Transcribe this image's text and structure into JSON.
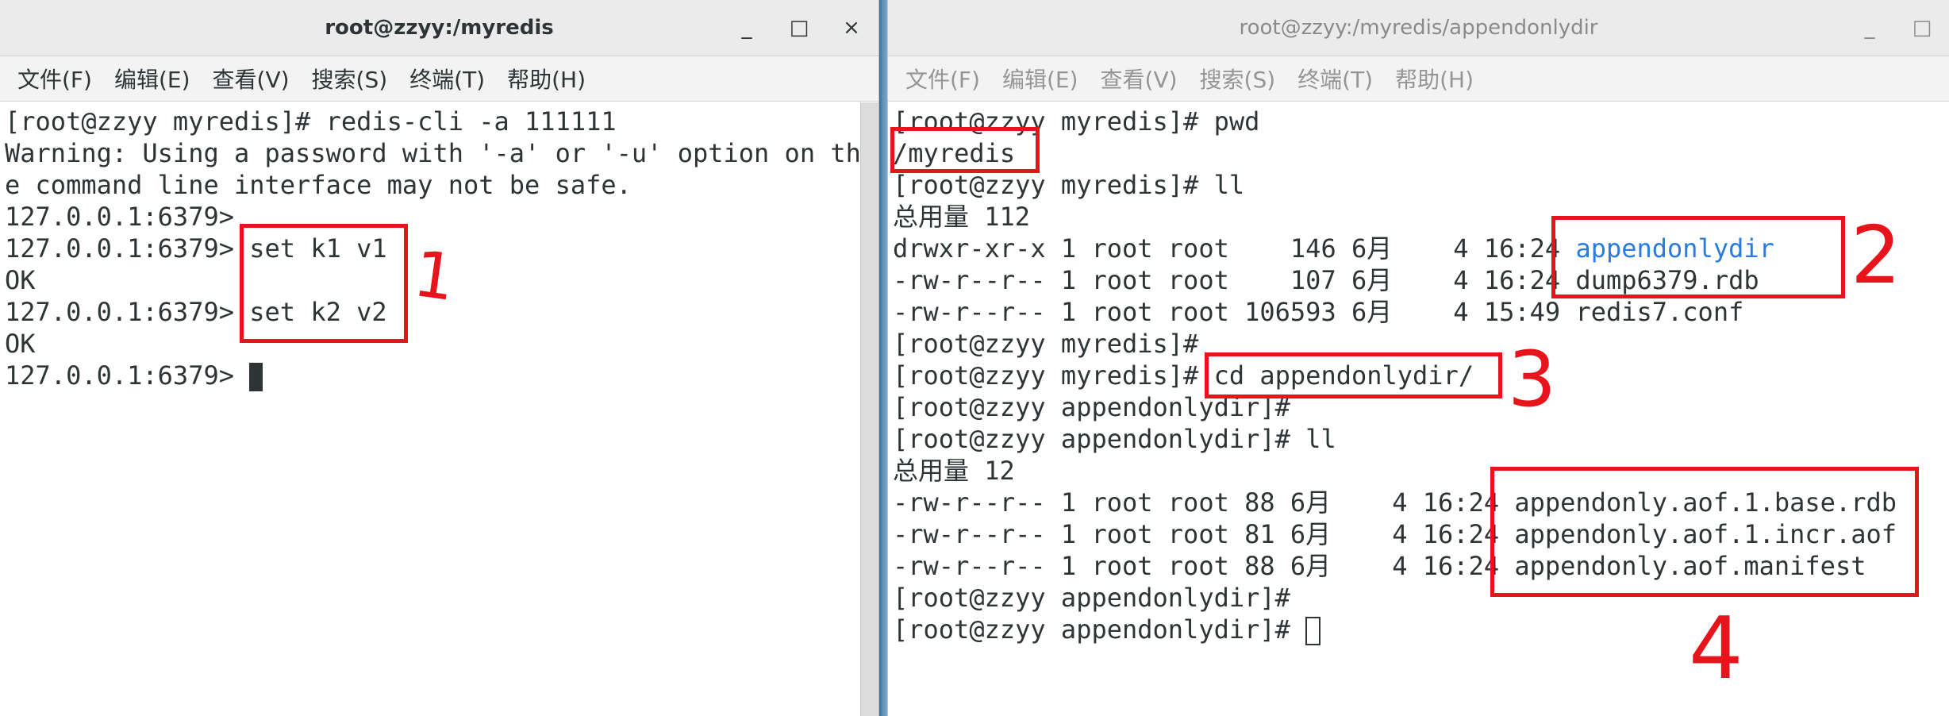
{
  "left_window": {
    "title": "root@zzyy:/myredis",
    "controls": {
      "minimize": "_",
      "maximize": "□",
      "close": "×"
    },
    "menu": [
      "文件(F)",
      "编辑(E)",
      "查看(V)",
      "搜索(S)",
      "终端(T)",
      "帮助(H)"
    ],
    "lines": [
      "[root@zzyy myredis]# redis-cli -a 111111",
      "Warning: Using a password with '-a' or '-u' option on th",
      "e command line interface may not be safe.",
      "127.0.0.1:6379>",
      "127.0.0.1:6379> set k1 v1",
      "OK",
      "127.0.0.1:6379> set k2 v2",
      "OK",
      "127.0.0.1:6379> "
    ]
  },
  "right_window": {
    "title": "root@zzyy:/myredis/appendonlydir",
    "controls": {
      "minimize": "_",
      "maximize": "□"
    },
    "menu": [
      "文件(F)",
      "编辑(E)",
      "查看(V)",
      "搜索(S)",
      "终端(T)",
      "帮助(H)"
    ],
    "lines": [
      "[root@zzyy myredis]# pwd",
      "/myredis",
      "[root@zzyy myredis]# ll",
      "总用量 112",
      {
        "prefix": "drwxr-xr-x 1 root root    146 6月    4 16:24 ",
        "name": "appendonlydir"
      },
      "-rw-r--r-- 1 root root    107 6月    4 16:24 dump6379.rdb",
      "-rw-r--r-- 1 root root 106593 6月    4 15:49 redis7.conf",
      "[root@zzyy myredis]#",
      "[root@zzyy myredis]# cd appendonlydir/",
      "[root@zzyy appendonlydir]#",
      "[root@zzyy appendonlydir]# ll",
      "总用量 12",
      "-rw-r--r-- 1 root root 88 6月    4 16:24 appendonly.aof.1.base.rdb",
      "-rw-r--r-- 1 root root 81 6月    4 16:24 appendonly.aof.1.incr.aof",
      "-rw-r--r-- 1 root root 88 6月    4 16:24 appendonly.aof.manifest",
      "[root@zzyy appendonlydir]#",
      "[root@zzyy appendonlydir]# "
    ]
  },
  "annotations": {
    "numbers": [
      "1",
      "2",
      "3",
      "4"
    ]
  },
  "colors": {
    "annotation_red": "#e8141b",
    "directory_blue": "#2a7be0",
    "terminal_text": "#2e3436",
    "title_bar": "#ebebeb",
    "divider_blue": "#5d8fb4"
  }
}
